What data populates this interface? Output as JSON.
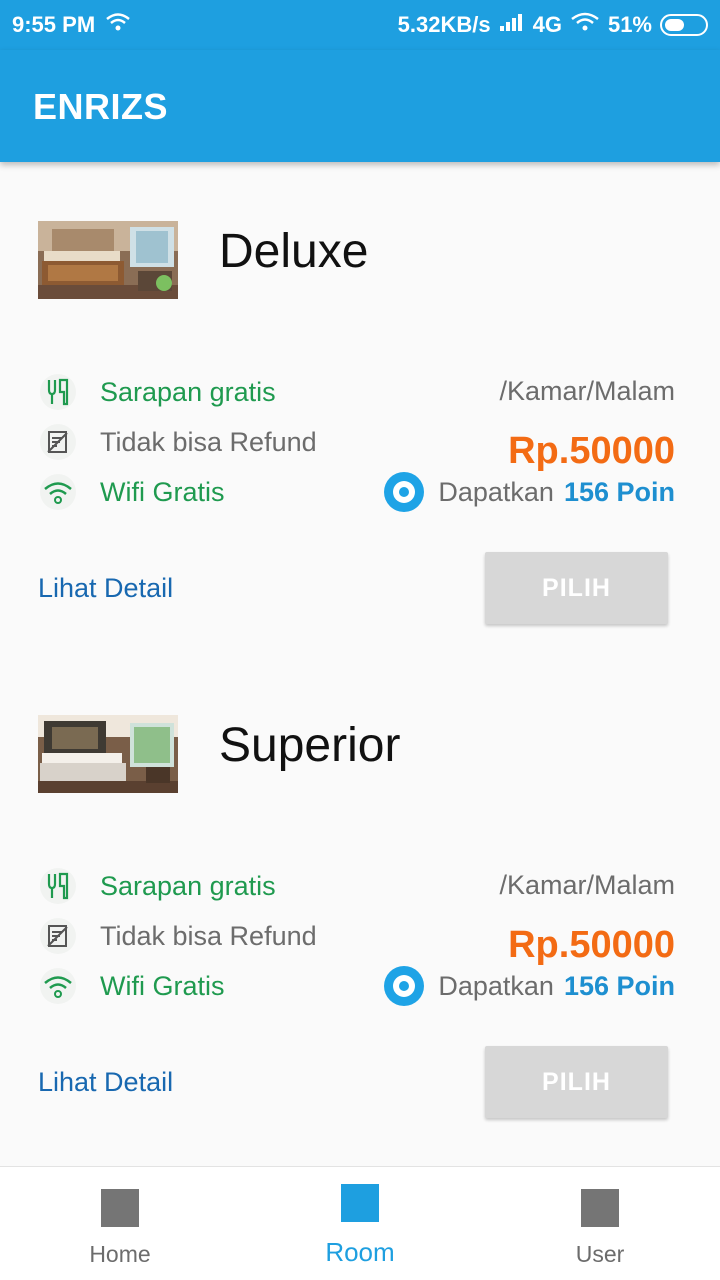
{
  "status_bar": {
    "time": "9:55 PM",
    "network_speed": "5.32KB/s",
    "network_type": "4G",
    "battery": "51%",
    "battery_level": 0.51
  },
  "app_bar": {
    "title": "ENRIZS"
  },
  "rooms": [
    {
      "name": "Deluxe",
      "amenities": [
        {
          "icon": "fork-knife-icon",
          "label": "Sarapan gratis"
        },
        {
          "icon": "no-refund-icon",
          "label": "Tidak bisa Refund"
        },
        {
          "icon": "wifi-icon",
          "label": "Wifi Gratis"
        }
      ],
      "per_night": "/Kamar/Malam",
      "price": "Rp.50000",
      "points_prefix": "Dapatkan",
      "points_value": "156 Poin",
      "detail_link": "Lihat Detail",
      "select_button": "PILIH"
    },
    {
      "name": "Superior",
      "amenities": [
        {
          "icon": "fork-knife-icon",
          "label": "Sarapan gratis"
        },
        {
          "icon": "no-refund-icon",
          "label": "Tidak bisa Refund"
        },
        {
          "icon": "wifi-icon",
          "label": "Wifi Gratis"
        }
      ],
      "per_night": "/Kamar/Malam",
      "price": "Rp.50000",
      "points_prefix": "Dapatkan",
      "points_value": "156 Poin",
      "detail_link": "Lihat Detail",
      "select_button": "PILIH"
    }
  ],
  "bottom_nav": {
    "active": "Room",
    "items": [
      {
        "label": "Home"
      },
      {
        "label": "Room"
      },
      {
        "label": "User"
      }
    ]
  },
  "colors": {
    "primary": "#1e9fe0",
    "price": "#f36b14",
    "amenity_green": "#1f9a4f",
    "link": "#1868b0",
    "button_disabled": "#d7d7d7"
  }
}
